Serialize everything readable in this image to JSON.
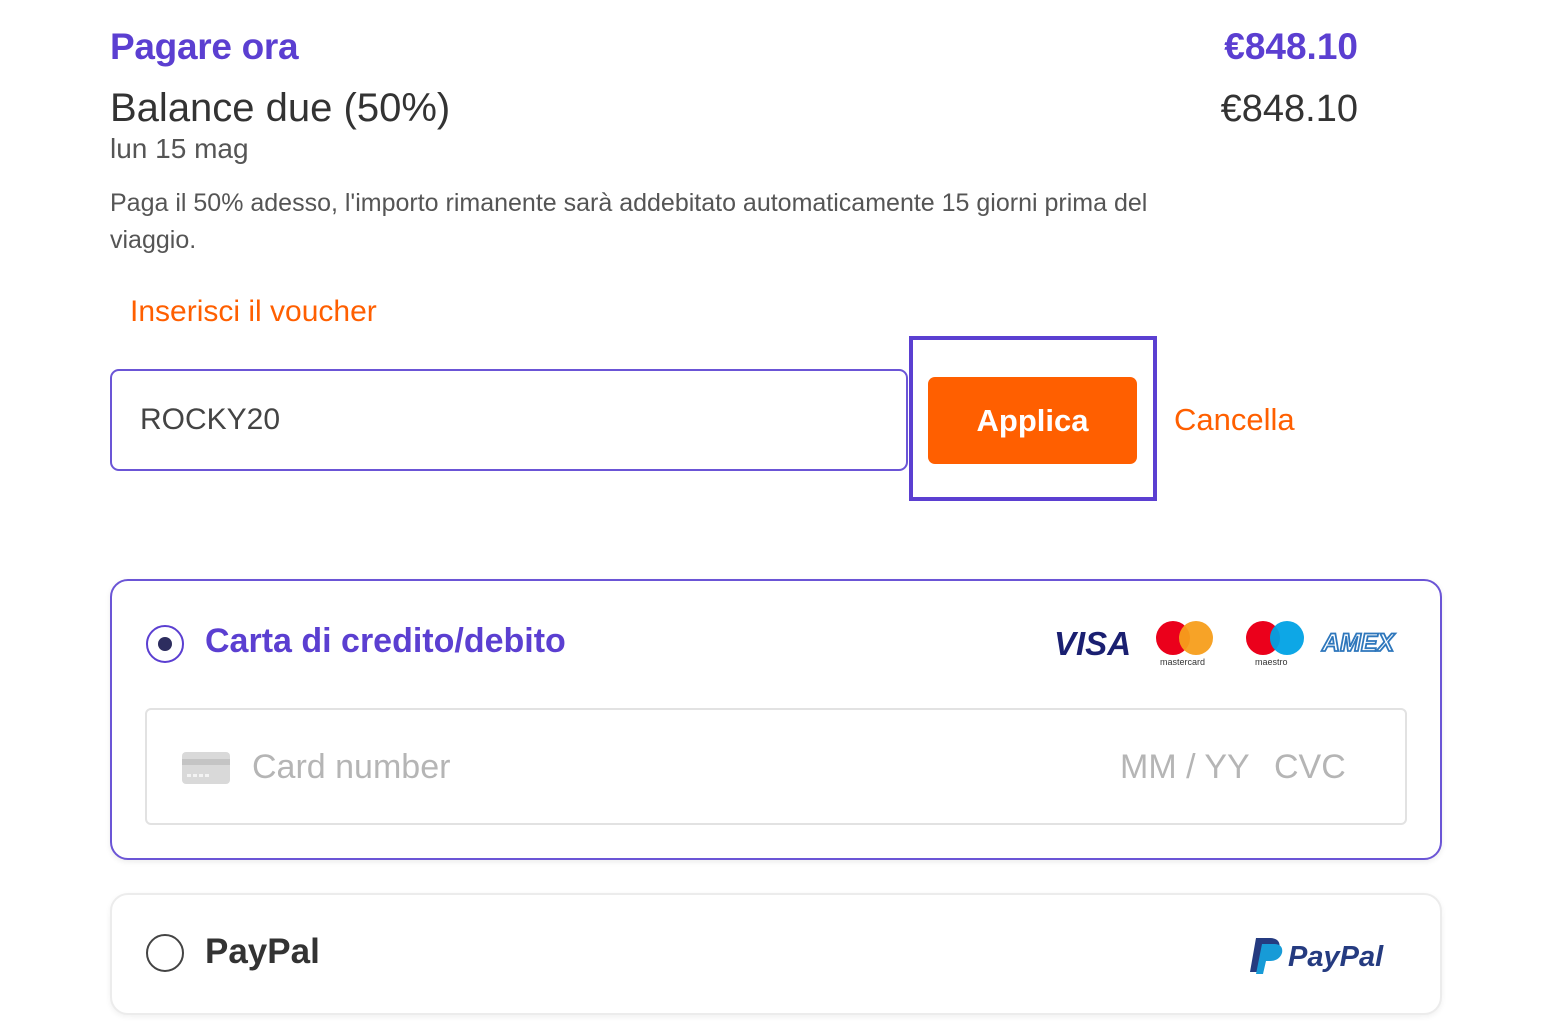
{
  "summary": {
    "pay_now_label": "Pagare ora",
    "pay_now_amount": "€848.10",
    "balance_label": "Balance due (50%)",
    "balance_amount": "€848.10",
    "balance_date": "lun 15 mag",
    "balance_note": "Paga il 50% adesso, l'importo rimanente sarà addebitato automaticamente 15 giorni prima del viaggio."
  },
  "voucher": {
    "title": "Inserisci il voucher",
    "input_value": "ROCKY20",
    "apply_label": "Applica",
    "cancel_label": "Cancella"
  },
  "payment_methods": {
    "card": {
      "label": "Carta di credito/debito",
      "selected": true,
      "logos": [
        "VISA",
        "mastercard",
        "maestro",
        "AMEX"
      ],
      "number_placeholder": "Card number",
      "expiry_placeholder": "MM / YY",
      "cvc_placeholder": "CVC"
    },
    "paypal": {
      "label": "PayPal",
      "selected": false,
      "logo_text": "PayPal"
    }
  },
  "colors": {
    "brand_purple": "#5b3fd1",
    "accent_orange": "#ff5f00"
  }
}
